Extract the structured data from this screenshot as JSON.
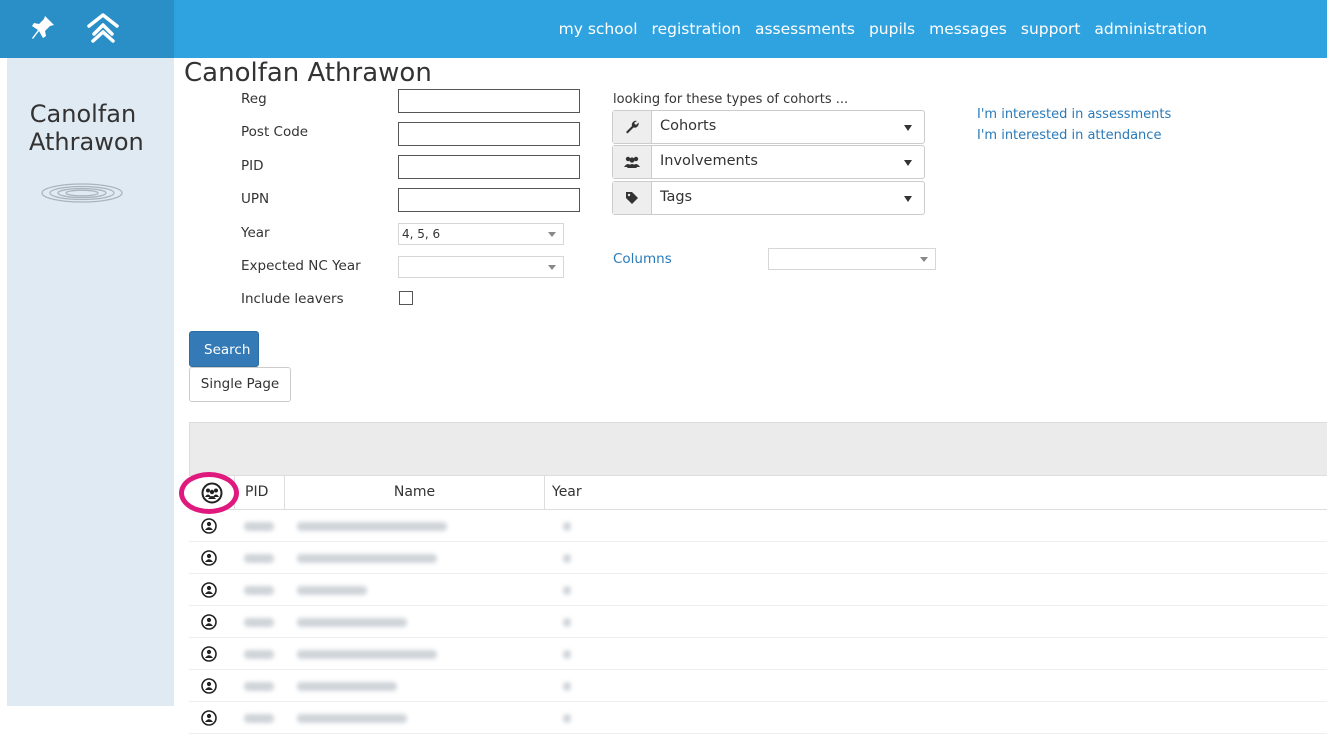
{
  "nav": {
    "items": [
      "my school",
      "registration",
      "assessments",
      "pupils",
      "messages",
      "support",
      "administration"
    ]
  },
  "sidebar": {
    "brand": "Canolfan Athrawon"
  },
  "page": {
    "title": "Canolfan Athrawon"
  },
  "form": {
    "reg_label": "Reg",
    "postcode_label": "Post Code",
    "pid_label": "PID",
    "upn_label": "UPN",
    "year_label": "Year",
    "year_value": "4, 5, 6",
    "expected_nc_label": "Expected NC Year",
    "expected_nc_value": "",
    "include_leavers_label": "Include leavers",
    "include_leavers_checked": false
  },
  "cohorts": {
    "title": "looking for these types of cohorts ...",
    "items": [
      {
        "label": "Cohorts",
        "icon": "wrench-icon"
      },
      {
        "label": "Involvements",
        "icon": "group-icon"
      },
      {
        "label": "Tags",
        "icon": "tag-icon"
      }
    ],
    "columns_label": "Columns",
    "columns_value": ""
  },
  "links": [
    "I'm interested in assessments",
    "I'm interested in attendance"
  ],
  "buttons": {
    "search": "Search",
    "single_page": "Single Page"
  },
  "grid": {
    "columns": [
      "PID",
      "Name",
      "Year"
    ],
    "row_count_visible": 7
  },
  "colors": {
    "nav_bg": "#2fa3e0",
    "sidebar_bg": "#e0eaf3",
    "primary_button": "#337ab7",
    "highlight_ring": "#e0197e",
    "link": "#2a7ab8"
  }
}
